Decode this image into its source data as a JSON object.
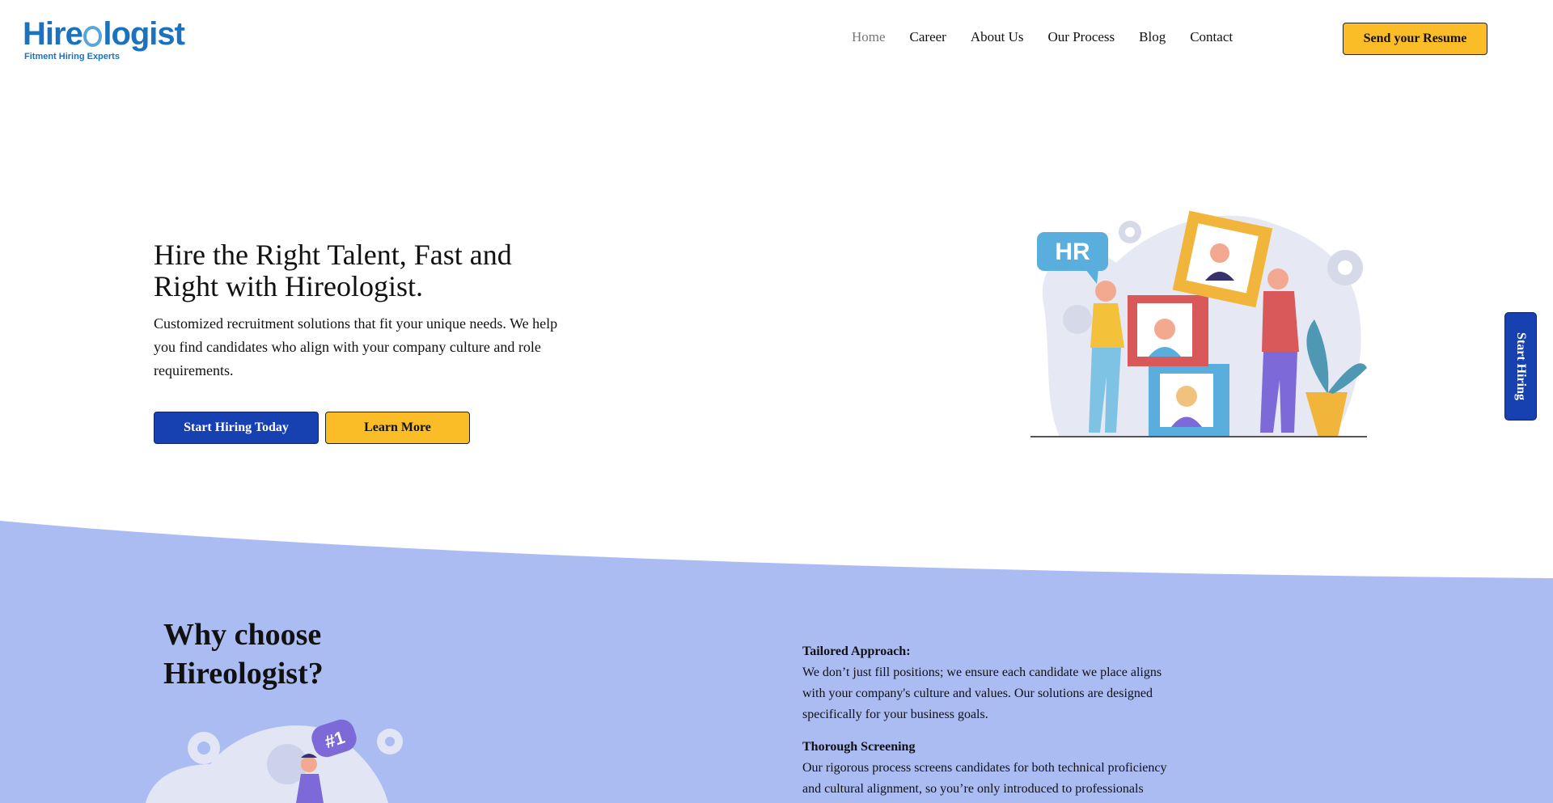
{
  "brand": {
    "logo_prefix": "Hire",
    "logo_suffix": "logist",
    "tagline": "Fitment Hiring Experts",
    "colors": {
      "primary": "#1740b0",
      "accent": "#fbbd27",
      "logo": "#1b73bf",
      "section_bg": "#abbcf3"
    }
  },
  "nav": {
    "items": [
      {
        "label": "Home",
        "active": true
      },
      {
        "label": "Career"
      },
      {
        "label": "About Us"
      },
      {
        "label": "Our Process"
      },
      {
        "label": "Blog"
      },
      {
        "label": "Contact"
      }
    ],
    "cta_label": "Send your Resume"
  },
  "hero": {
    "title": "Hire the Right Talent, Fast and Right with Hireologist.",
    "description": "Customized recruitment solutions that fit your unique needs. We help you find candidates who align with your company culture and role requirements.",
    "primary_button": "Start Hiring Today",
    "secondary_button": "Learn More",
    "illustration_badge": "HR"
  },
  "side_tab": {
    "label": "Start Hiring"
  },
  "why": {
    "title": "Why choose Hireologist?",
    "illustration_badge": "#1",
    "features": [
      {
        "title": "Tailored Approach:",
        "text": "We don’t just fill positions; we ensure each candidate we place aligns with your company's culture and values. Our solutions are designed specifically for your business goals."
      },
      {
        "title": "Thorough Screening",
        "text": "Our rigorous process screens candidates for both technical proficiency and cultural alignment, so you’re only introduced to professionals"
      }
    ]
  }
}
